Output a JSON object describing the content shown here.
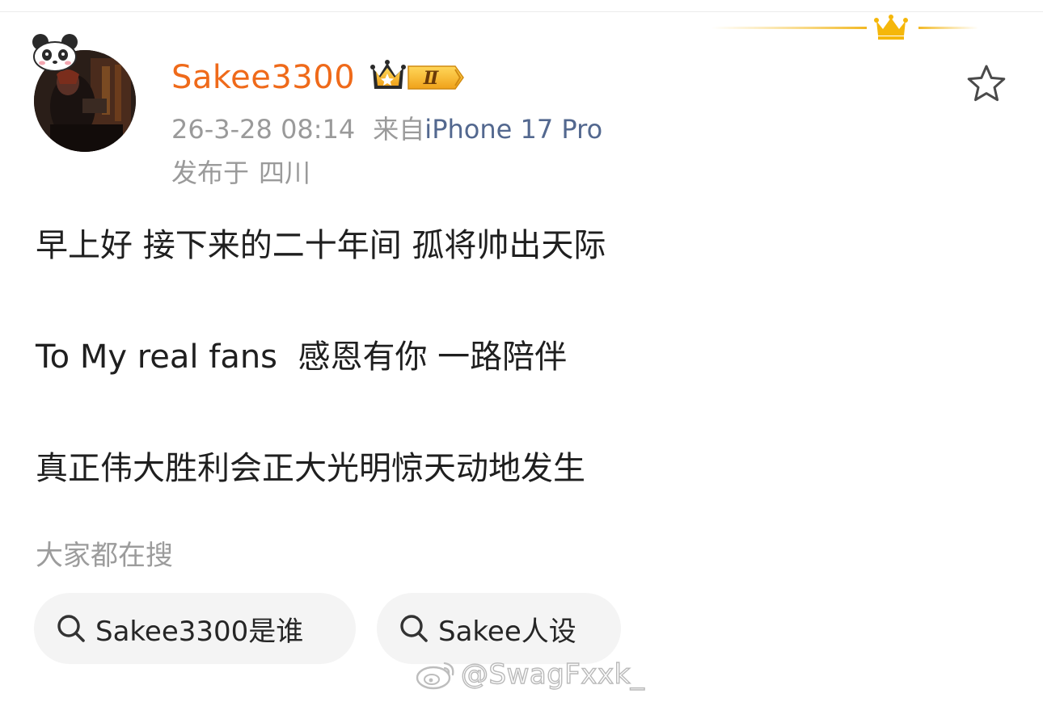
{
  "post": {
    "author": {
      "username": "Sakee3300",
      "username_color": "#ef6a1a",
      "vip_badge": {
        "icon": "crown-icon",
        "level": "Ⅱ"
      },
      "avatar": {
        "icon": "avatar-photo",
        "decoration": "panda-icon"
      }
    },
    "meta": {
      "date": "26-3-28 08:14",
      "source_prefix": "来自",
      "source_device": "iPhone 17 Pro",
      "location_prefix": "发布于",
      "location": "四川"
    },
    "favorite_icon": "star-outline-icon",
    "content": {
      "line1": "早上好 接下来的二十年间 孤将帅出天际",
      "line2": "To My real fans  感恩有你 一路陪伴",
      "line3": "真正伟大胜利会正大光明惊天动地发生"
    }
  },
  "search_suggestions": {
    "title": "大家都在搜",
    "chips": [
      {
        "icon": "search-icon",
        "label": "Sakee3300是谁"
      },
      {
        "icon": "search-icon",
        "label": "Sakee人设"
      }
    ]
  },
  "watermark": {
    "logo": "weibo-logo-icon",
    "text": "@SwagFxxk_"
  },
  "colors": {
    "accent_orange": "#ef6a1a",
    "link_blue": "#53688f",
    "meta_gray": "#9a9a9a",
    "crown_gold": "#f5b70a"
  }
}
